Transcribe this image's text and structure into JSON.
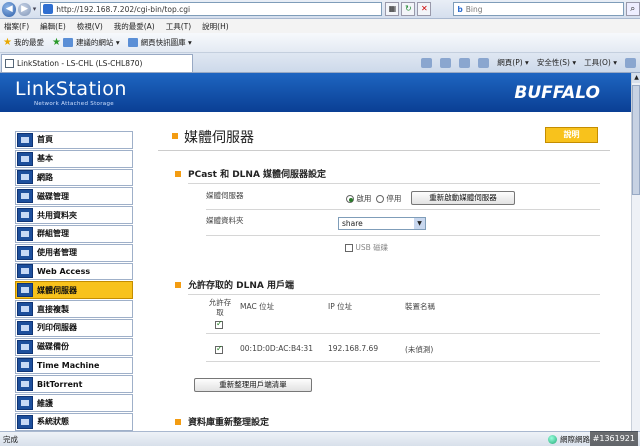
{
  "browser": {
    "url": "http://192.168.7.202/cgi-bin/top.cgi",
    "search_placeholder": "Bing",
    "menu": [
      "檔案(F)",
      "編輯(E)",
      "檢視(V)",
      "我的最愛(A)",
      "工具(T)",
      "說明(H)"
    ],
    "favorites": {
      "label": "我的最愛",
      "items": [
        "建議的網站 ▾",
        "網頁快訊圖庫 ▾"
      ]
    },
    "tab_title": "LinkStation - LS-CHL (LS-CHL870)",
    "commands": [
      "網頁(P) ▾",
      "安全性(S) ▾",
      "工具(O) ▾"
    ],
    "status_left": "完成",
    "status_zone": "網際網路",
    "watermark": "#1361921"
  },
  "header": {
    "logo": "LinkStation",
    "logo_sub": "Network Attached Storage",
    "brand": "BUFFALO"
  },
  "sidebar": {
    "items": [
      {
        "label": "首頁",
        "active": false
      },
      {
        "label": "基本",
        "active": false
      },
      {
        "label": "網路",
        "active": false
      },
      {
        "label": "磁碟管理",
        "active": false
      },
      {
        "label": "共用資料夾",
        "active": false
      },
      {
        "label": "群組管理",
        "active": false
      },
      {
        "label": "使用者管理",
        "active": false
      },
      {
        "label": "Web Access",
        "active": false
      },
      {
        "label": "媒體伺服器",
        "active": true
      },
      {
        "label": "直接複製",
        "active": false
      },
      {
        "label": "列印伺服器",
        "active": false
      },
      {
        "label": "磁碟備份",
        "active": false
      },
      {
        "label": "Time Machine",
        "active": false
      },
      {
        "label": "BitTorrent",
        "active": false
      },
      {
        "label": "維護",
        "active": false
      },
      {
        "label": "系統狀態",
        "active": false
      }
    ]
  },
  "main": {
    "title": "媒體伺服器",
    "help": "說明",
    "dlna_section": {
      "title": "PCast 和 DLNA 媒體伺服器設定",
      "server_label": "媒體伺服器",
      "enable_label": "啟用",
      "disable_label": "停用",
      "restart_button": "重新啟動媒體伺服器",
      "folder_label": "媒體資料夾",
      "folder_value": "share",
      "usb_label": "USB 磁碟"
    },
    "clients_section": {
      "title": "允許存取的 DLNA 用戶端",
      "headers": {
        "allow": "允許存取",
        "mac": "MAC 位址",
        "ip": "IP 位址",
        "name": "裝置名稱"
      },
      "rows": [
        {
          "mac": "00:1D:0D:AC:B4:31",
          "ip": "192.168.7.69",
          "name": "(未偵測)"
        }
      ],
      "refresh_button": "重新整理用戶端清單"
    },
    "db_section": {
      "title": "資料庫重新整理設定"
    }
  }
}
